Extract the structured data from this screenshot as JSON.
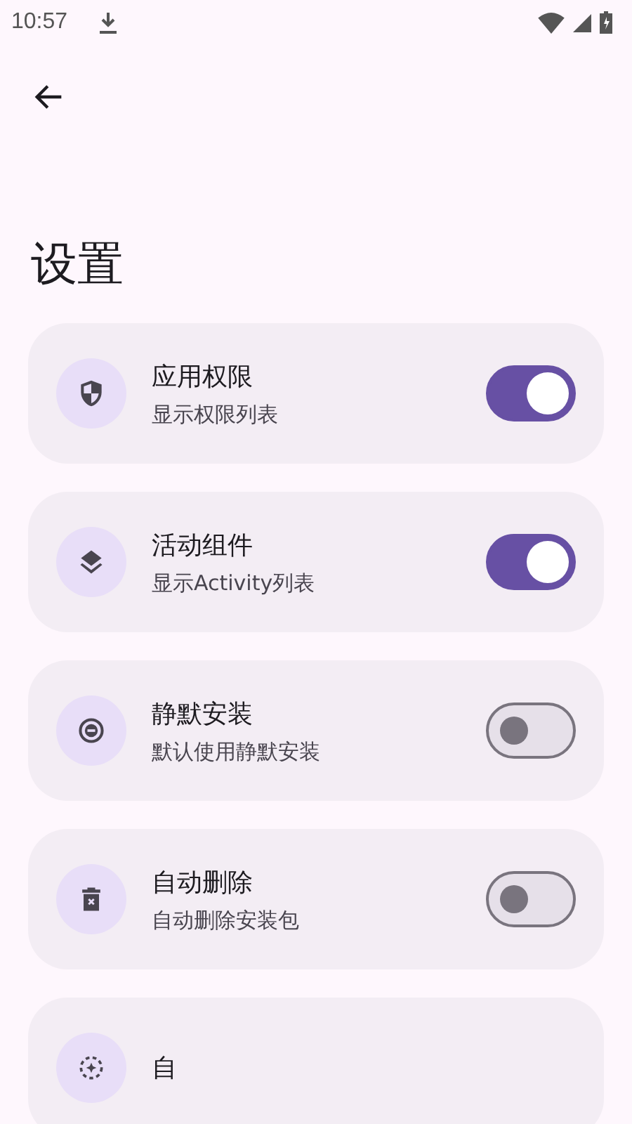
{
  "status_bar": {
    "time": "10:57"
  },
  "title": "设置",
  "settings": [
    {
      "title": "应用权限",
      "subtitle": "显示权限列表",
      "on": true
    },
    {
      "title": "活动组件",
      "subtitle": "显示Activity列表",
      "on": true
    },
    {
      "title": "静默安装",
      "subtitle": "默认使用静默安装",
      "on": false
    },
    {
      "title": "自动删除",
      "subtitle": "自动删除安装包",
      "on": false
    },
    {
      "title": "自"
    }
  ]
}
